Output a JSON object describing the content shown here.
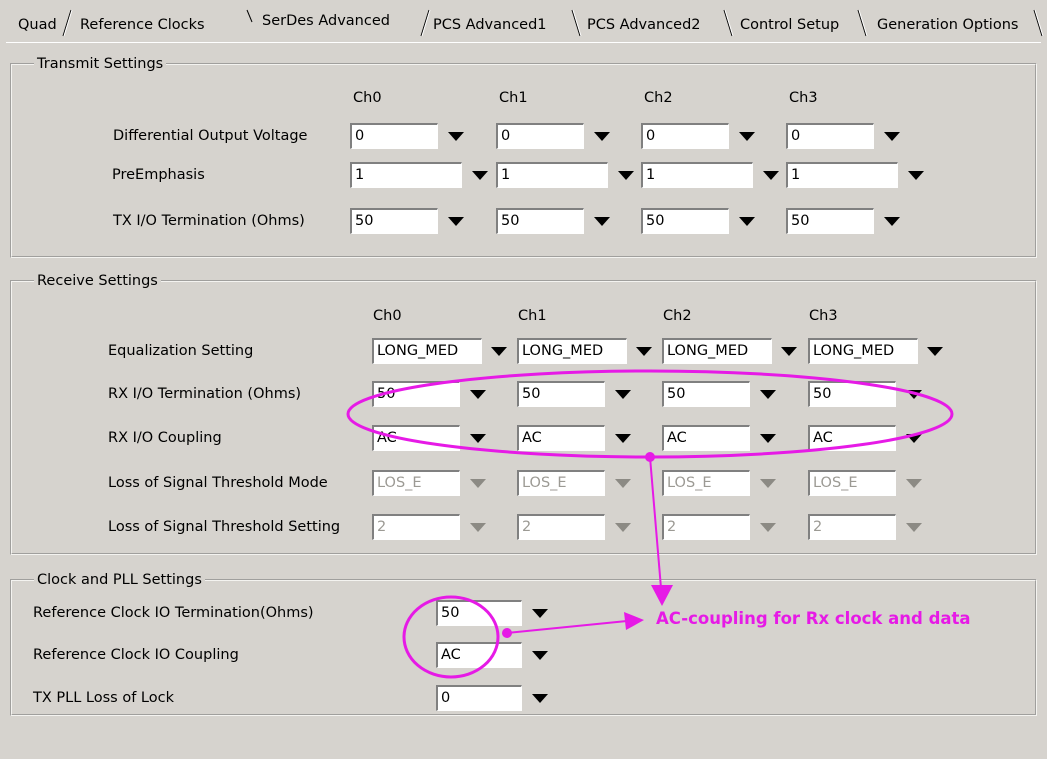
{
  "tabs": [
    "Quad",
    "Reference Clocks",
    "SerDes Advanced",
    "PCS Advanced1",
    "PCS Advanced2",
    "Control Setup",
    "Generation Options"
  ],
  "active_tab": "SerDes Advanced",
  "transmit": {
    "title": "Transmit Settings",
    "channels": [
      "Ch0",
      "Ch1",
      "Ch2",
      "Ch3"
    ],
    "rows": [
      {
        "label": "Differential Output Voltage",
        "values": [
          "0",
          "0",
          "0",
          "0"
        ]
      },
      {
        "label": "PreEmphasis",
        "values": [
          "1",
          "1",
          "1",
          "1"
        ]
      },
      {
        "label": "TX I/O Termination (Ohms)",
        "values": [
          "50",
          "50",
          "50",
          "50"
        ]
      }
    ]
  },
  "receive": {
    "title": "Receive Settings",
    "channels": [
      "Ch0",
      "Ch1",
      "Ch2",
      "Ch3"
    ],
    "rows": [
      {
        "label": "Equalization Setting",
        "values": [
          "LONG_MED",
          "LONG_MED",
          "LONG_MED",
          "LONG_MED"
        ],
        "disabled": false
      },
      {
        "label": "RX I/O Termination (Ohms)",
        "values": [
          "50",
          "50",
          "50",
          "50"
        ],
        "disabled": false
      },
      {
        "label": "RX I/O Coupling",
        "values": [
          "AC",
          "AC",
          "AC",
          "AC"
        ],
        "disabled": false
      },
      {
        "label": "Loss of Signal Threshold Mode",
        "values": [
          "LOS_E",
          "LOS_E",
          "LOS_E",
          "LOS_E"
        ],
        "disabled": true
      },
      {
        "label": "Loss of Signal Threshold Setting",
        "values": [
          "2",
          "2",
          "2",
          "2"
        ],
        "disabled": true
      }
    ]
  },
  "clock": {
    "title": "Clock and PLL Settings",
    "rows": [
      {
        "label": "Reference Clock IO Termination(Ohms)",
        "value": "50"
      },
      {
        "label": "Reference Clock IO Coupling",
        "value": "AC"
      },
      {
        "label": "TX PLL Loss of Lock",
        "value": "0"
      }
    ]
  },
  "annotation": {
    "text": "AC-coupling for Rx clock and data",
    "color": "#e61ae6"
  },
  "colors": {
    "background": "#d6d3ce",
    "field_bg": "#ffffff",
    "disabled_text": "#9c9a94"
  }
}
